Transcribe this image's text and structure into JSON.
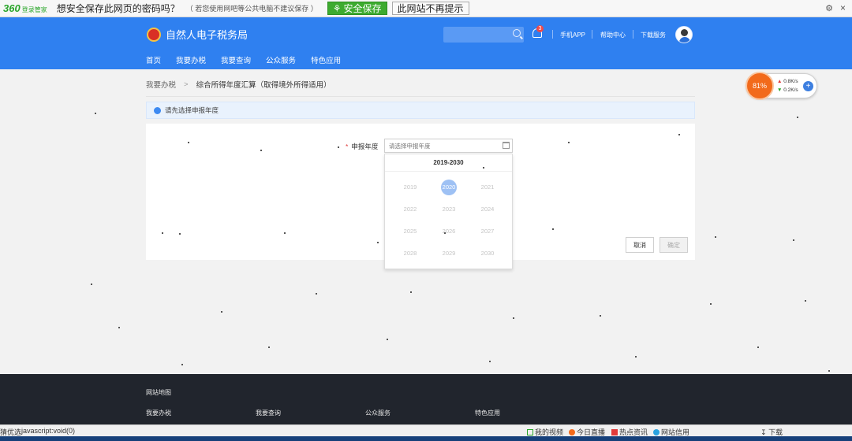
{
  "pwbar": {
    "logo_number": "360",
    "logo_sub": "登录管家",
    "question": "想安全保存此网页的密码吗？",
    "note": "（ 若您使用网吧等公共电脑不建议保存 ）",
    "save_label": "安全保存",
    "never_label": "此网站不再提示"
  },
  "header": {
    "site_name": "自然人电子税务局",
    "bell_count": "3",
    "links": [
      "手机APP",
      "帮助中心",
      "下载服务"
    ]
  },
  "nav": [
    "首页",
    "我要办税",
    "我要查询",
    "公众服务",
    "特色应用"
  ],
  "breadcrumb": {
    "parent": "我要办税",
    "separator": ">",
    "current": "综合所得年度汇算（取得境外所得适用）"
  },
  "info_text": "请先选择申报年度",
  "form": {
    "year_label": "申报年度",
    "year_placeholder": "请选择申报年度",
    "cancel_label": "取消",
    "ok_label": "确定"
  },
  "year_picker": {
    "range": "2019-2030",
    "years": [
      "2019",
      "2020",
      "2021",
      "2022",
      "2023",
      "2024",
      "2025",
      "2026",
      "2027",
      "2028",
      "2029",
      "2030"
    ],
    "selected": "2020"
  },
  "speed_widget": {
    "percent": "81%",
    "up": "0.8K/s",
    "down": "0.2K/s"
  },
  "footer": {
    "title": "网站地图",
    "columns": [
      "我要办税",
      "我要查询",
      "公众服务",
      "特色应用"
    ]
  },
  "statusbar": {
    "left": "猜优选",
    "url": "javascript:void(0)",
    "items": [
      "我的视频",
      "今日直播",
      "热点资讯",
      "网站信用"
    ],
    "download": "下载"
  },
  "colors": {
    "header_blue": "#2f80f0",
    "footer_dark": "#21252d",
    "save_green": "#3dab2f",
    "speed_orange": "#f26a1b"
  }
}
